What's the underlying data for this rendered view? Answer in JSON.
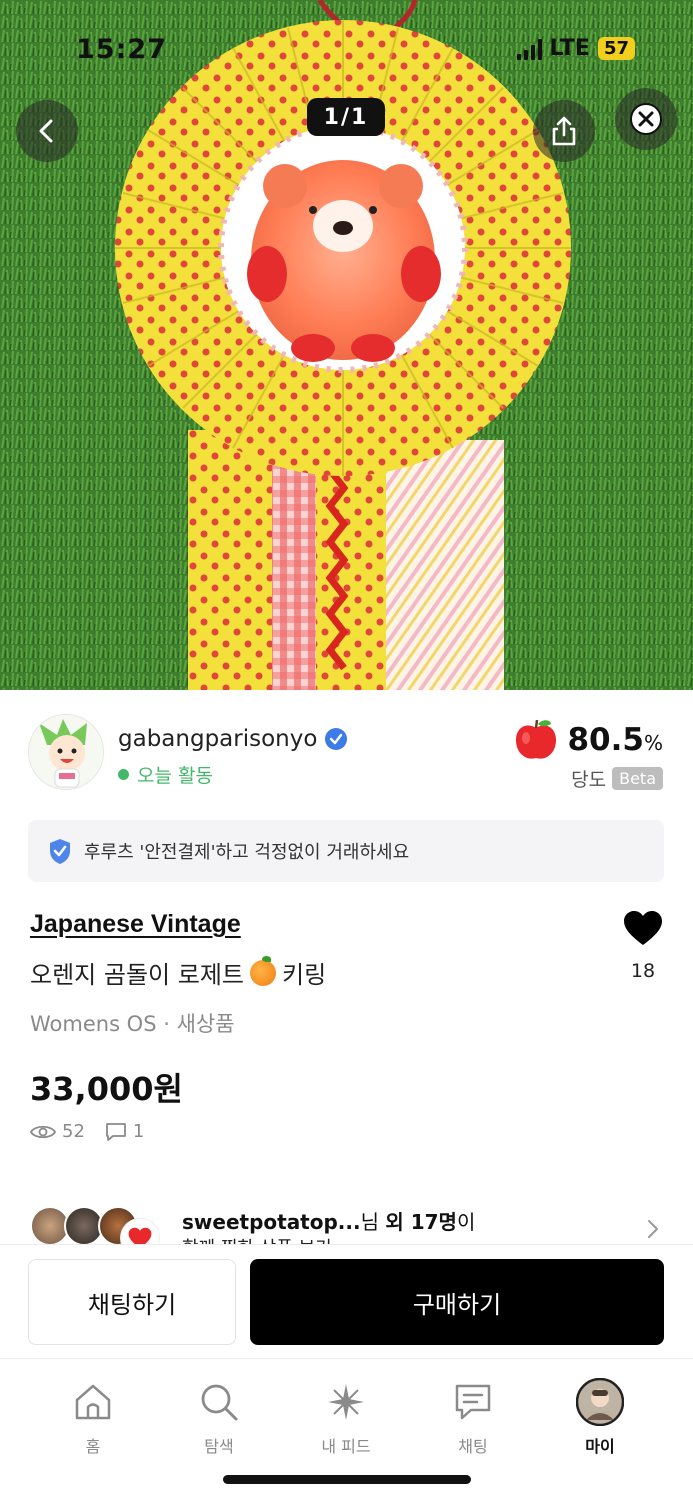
{
  "status_bar": {
    "time": "15:27",
    "network": "LTE",
    "battery": "57"
  },
  "hero": {
    "image_counter": "1/1",
    "page_dots_total": 10,
    "page_dots_active": 0,
    "icons": {
      "back": "chevron-left-icon",
      "share": "share-icon",
      "close": "close-icon"
    }
  },
  "seller": {
    "username": "gabangparisonyo",
    "activity": "오늘 활동",
    "score_value": "80.5",
    "score_unit": "%",
    "score_label": "당도",
    "beta_label": "Beta",
    "colors": {
      "activity": "#44b86a",
      "verified": "#3d7be8"
    }
  },
  "safe_banner": {
    "text": "후루츠 '안전결제'하고 걱정없이 거래하세요"
  },
  "product": {
    "brand": "Japanese Vintage",
    "title": "오렌지 곰돌이 로제트",
    "title_suffix": "키링",
    "category": "Womens OS · 새상품",
    "price": "33,000원",
    "views": "52",
    "comments": "1",
    "likes": "18"
  },
  "saved_by": {
    "name": "sweetpotatop...",
    "suffix_prefix": "님 ",
    "suffix_bold": "외 17명",
    "suffix_end": "이",
    "subtext": "함께 찜한 상품 보기"
  },
  "actions": {
    "chat_label": "채팅하기",
    "buy_label": "구매하기"
  },
  "tabbar": {
    "items": [
      {
        "label": "홈",
        "icon": "home-icon"
      },
      {
        "label": "탐색",
        "icon": "search-icon"
      },
      {
        "label": "내 피드",
        "icon": "sparkle-icon"
      },
      {
        "label": "채팅",
        "icon": "chat-icon"
      },
      {
        "label": "마이",
        "icon": "profile-avatar-icon",
        "active": true
      }
    ]
  }
}
